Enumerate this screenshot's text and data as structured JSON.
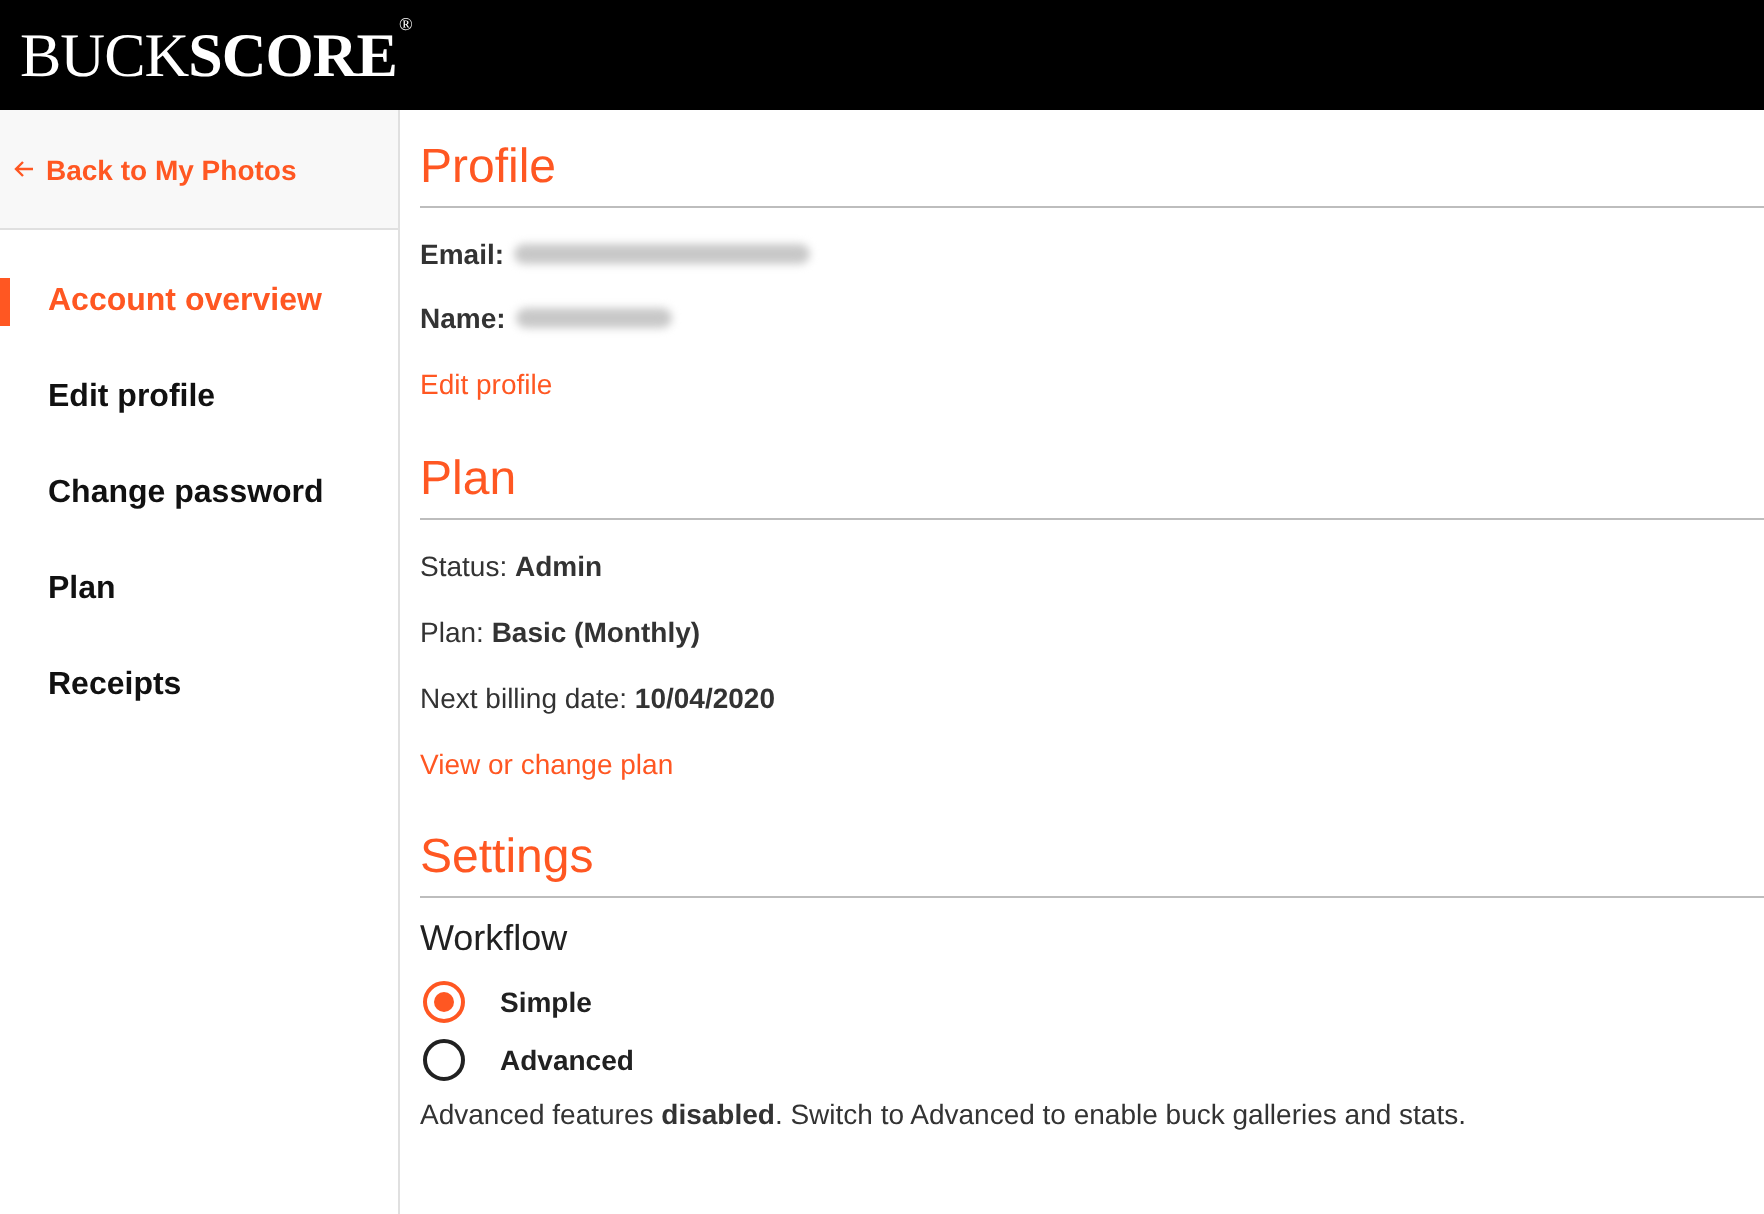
{
  "header": {
    "logo": "BUCK**SCORE**$^{®}$"
  },
  "sidebar": {
    "back_link": "Back to My Photos",
    "items": [
      {
        "label": "Account overview",
        "selected": true
      },
      {
        "label": "Edit profile",
        "selected": false
      },
      {
        "label": "Change password",
        "selected": false
      },
      {
        "label": "Plan",
        "selected": false
      },
      {
        "label": "Receipts",
        "selected": false
      }
    ]
  },
  "profile": {
    "title": "Profile",
    "fields": [
      {
        "label": "Email:",
        "value_blurred": true
      },
      {
        "label": "Name:",
        "value_blurred": true
      }
    ],
    "link": "Edit profile"
  },
  "plan": {
    "title": "Plan",
    "rows": [
      "Status: **Admin**",
      "Plan: **Basic (Monthly)**",
      "Next billing date: **10/04/2020**"
    ],
    "link": "View or change plan"
  },
  "settings": {
    "title": "Settings",
    "subtitle": "Workflow",
    "options": [
      {
        "label": "Simple",
        "selected": true
      },
      {
        "label": "Advanced",
        "selected": false
      }
    ],
    "note": "Advanced features **disabled**. Switch to Advanced to enable buck galleries and stats."
  }
}
